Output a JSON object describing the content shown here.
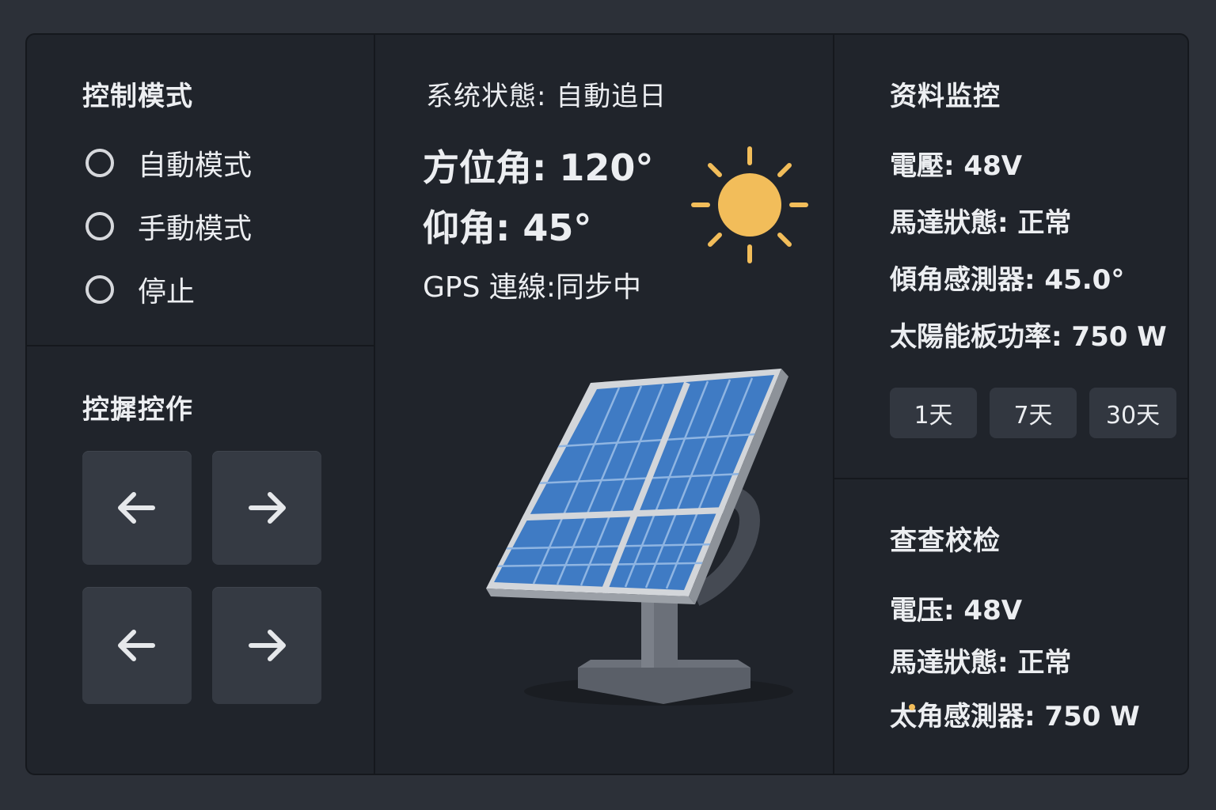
{
  "control_mode": {
    "title": "控制模式",
    "options": [
      {
        "label": "自動模式"
      },
      {
        "label": "手動模式"
      },
      {
        "label": "停止"
      }
    ]
  },
  "joystick": {
    "title": "控摨控作",
    "buttons": [
      {
        "icon": "arrow-left-icon"
      },
      {
        "icon": "arrow-right-icon"
      },
      {
        "icon": "arrow-left-icon"
      },
      {
        "icon": "arrow-right-icon"
      }
    ]
  },
  "status": {
    "title": "系统状態: 自動追日",
    "azimuth": "方位角: 120°",
    "elevation": "仰角: 45°",
    "gps": "GPS 連線:同步中",
    "sun_icon": "sun-icon",
    "panel_icon": "solar-panel-icon",
    "sun_color": "#f2bd5a",
    "panel_color": "#3f7bc4"
  },
  "monitor": {
    "title": "资料监控",
    "voltage": "電壓: 48V",
    "motor": "馬達狀態: 正常",
    "tilt": "傾角感測器: 45.0°",
    "power": "太陽能板功率: 750 W",
    "ranges": [
      "1天",
      "7天",
      "30天"
    ]
  },
  "check": {
    "title": "查查校检",
    "voltage": "電压: 48V",
    "motor": "馬達狀態: 正常",
    "sensor": "太角感測器: 750 W"
  }
}
